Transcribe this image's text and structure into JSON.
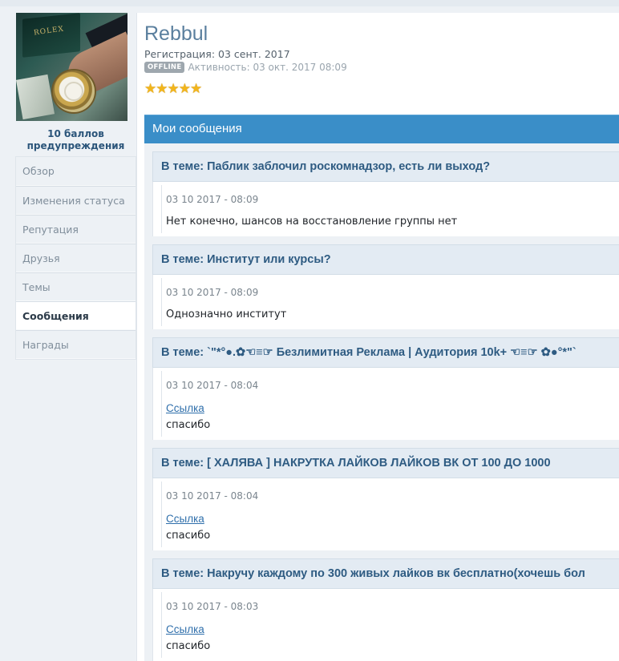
{
  "profile": {
    "username": "Rebbul",
    "registration": "Регистрация: 03 сент. 2017",
    "status_badge": "OFFLINE",
    "activity": "Активность: 03 окт. 2017 08:09",
    "rating_stars": 5,
    "warnings": "10 баллов предупреждения",
    "avatar_logo_text": "ROLEX"
  },
  "sidebar": {
    "items": [
      {
        "label": "Обзор"
      },
      {
        "label": "Изменения статуса"
      },
      {
        "label": "Репутация"
      },
      {
        "label": "Друзья"
      },
      {
        "label": "Темы"
      },
      {
        "label": "Сообщения",
        "active": true
      },
      {
        "label": "Награды"
      }
    ]
  },
  "section": {
    "title": "Мои сообщения"
  },
  "messages": [
    {
      "topic": "В теме: Паблик заблочил роскомнадзор, есть ли выход?",
      "date": "03 10 2017 - 08:09",
      "text": "Нет конечно, шансов на восстановление группы нет"
    },
    {
      "topic": "В теме: Институт или курсы?",
      "date": "03 10 2017 - 08:09",
      "text": "Однозначно институт"
    },
    {
      "topic": "В теме: `\"*°●.✿☜≡☞ Безлимитная Реклама | Аудитория 10k+ ☜≡☞ ✿●°*\"`",
      "date": "03 10 2017 - 08:04",
      "link": "Ссылка",
      "text": "спасибо"
    },
    {
      "topic": "В теме: [ ХАЛЯВА ] НАКРУТКА ЛАЙКОВ ЛАЙКОВ ВК ОТ 100 ДО 1000",
      "date": "03 10 2017 - 08:04",
      "link": "Ссылка",
      "text": "спасибо"
    },
    {
      "topic": "В теме: Накручу каждому по 300 живых лайков вк бесплатно(хочешь бол",
      "date": "03 10 2017 - 08:03",
      "link": "Ссылка",
      "text": "спасибо"
    }
  ],
  "colors": {
    "accent": "#3a8ec8",
    "topic_text": "#2e5b82",
    "link": "#2f6fab",
    "star": "#f2b51c"
  }
}
